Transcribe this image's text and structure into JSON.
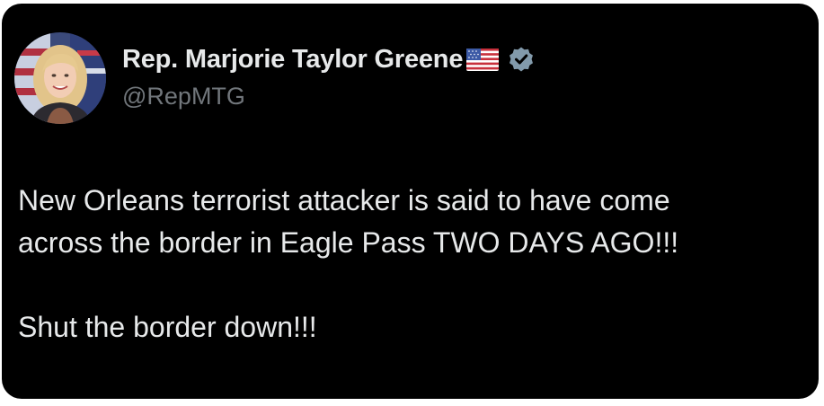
{
  "author": {
    "display_name": "Rep. Marjorie Taylor Greene",
    "handle": "@RepMTG",
    "avatar": "profile-photo",
    "badges": [
      "us-flag-icon",
      "verified-badge-icon"
    ],
    "verified_color": "#829aab"
  },
  "tweet": {
    "lines": [
      "New Orleans terrorist attacker is said to have come",
      "across the border in Eagle Pass TWO DAYS AGO!!!"
    ],
    "closing": "Shut the border down!!!"
  },
  "colors": {
    "background": "#000000",
    "text": "#e7e9ea",
    "muted": "#71767b"
  }
}
